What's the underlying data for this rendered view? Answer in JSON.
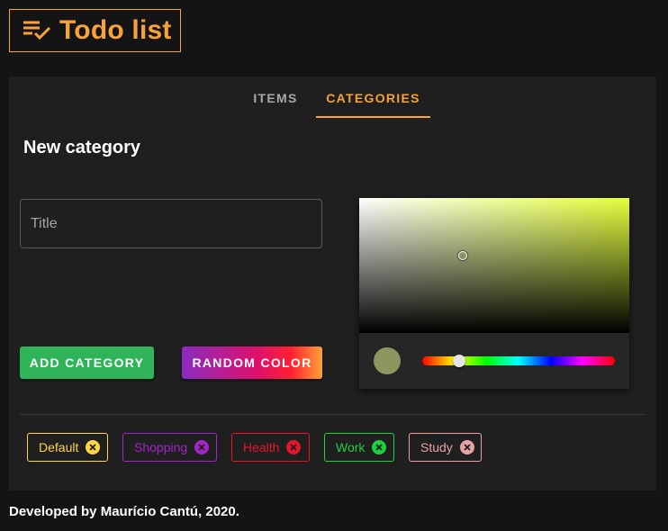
{
  "app": {
    "title": "Todo list"
  },
  "tabs": [
    {
      "label": "ITEMS",
      "active": false
    },
    {
      "label": "CATEGORIES",
      "active": true
    }
  ],
  "form": {
    "section_title": "New category",
    "title_placeholder": "Title",
    "title_value": "",
    "add_label": "ADD CATEGORY",
    "random_label": "RANDOM COLOR",
    "selected_color": "#8e9560"
  },
  "categories": [
    {
      "name": "Default",
      "color": "#ffd54a"
    },
    {
      "name": "Shopping",
      "color": "#a425c9"
    },
    {
      "name": "Health",
      "color": "#e2172e"
    },
    {
      "name": "Work",
      "color": "#1fd13f"
    },
    {
      "name": "Study",
      "color": "#e8a3a3"
    }
  ],
  "footer": {
    "text": "Developed by Maurício Cantú, 2020."
  },
  "colors": {
    "accent": "#f7a23b",
    "background": "#141414",
    "card": "#1f1f1f",
    "add_button": "#2fb45a"
  }
}
